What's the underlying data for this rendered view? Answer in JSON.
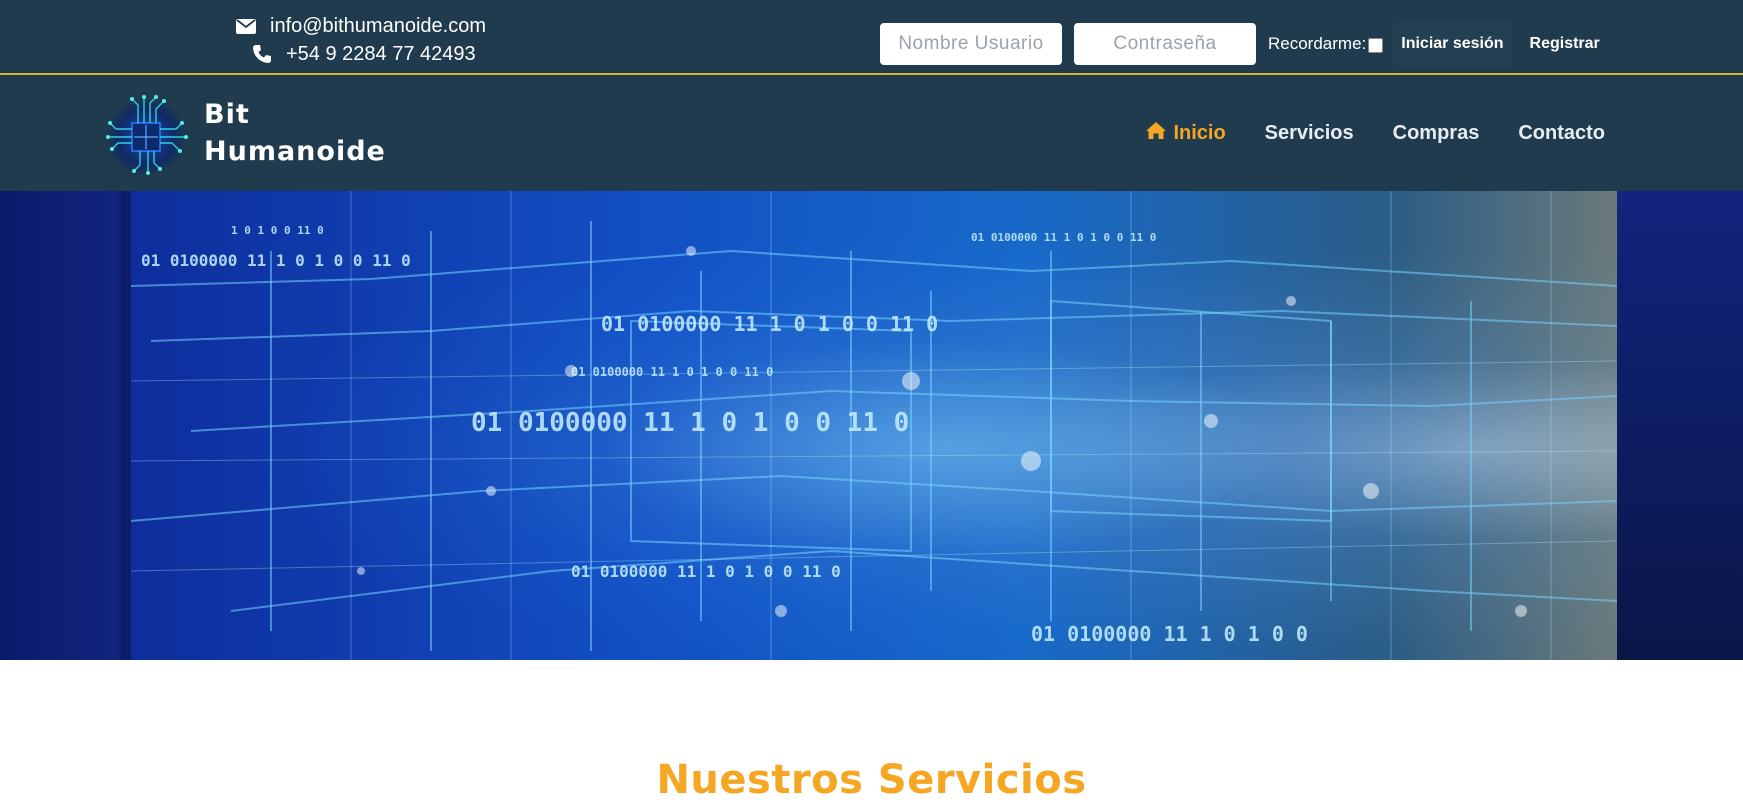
{
  "topbar": {
    "email": "info@bithumanoide.com",
    "phone": "+54 9 2284 77 42493",
    "username_placeholder": "Nombre Usuario",
    "password_placeholder": "Contraseña",
    "remember_label": "Recordarme:",
    "login_label": "Iniciar sesión",
    "register_label": "Registrar"
  },
  "brand": {
    "line1": "Bit",
    "line2": "Humanoide"
  },
  "nav": {
    "items": [
      {
        "label": "Inicio",
        "active": true
      },
      {
        "label": "Servicios"
      },
      {
        "label": "Compras"
      },
      {
        "label": "Contacto"
      }
    ]
  },
  "hero": {
    "binary_text": [
      "01",
      "0100000",
      "11",
      "1",
      "0",
      "1",
      "0",
      "0",
      "11",
      "0"
    ]
  },
  "services": {
    "title": "Nuestros Servicios"
  },
  "colors": {
    "bar_bg": "#1f3b4d",
    "accent": "#f5a623",
    "border": "#d9b23a"
  }
}
